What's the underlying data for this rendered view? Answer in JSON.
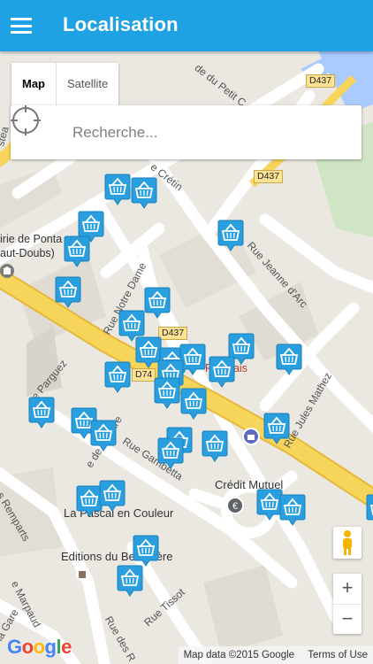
{
  "appbar": {
    "title": "Localisation",
    "menu_icon": "hamburger-menu-icon"
  },
  "map_type": {
    "map_label": "Map",
    "satellite_label": "Satellite",
    "selected": "Map"
  },
  "search": {
    "placeholder": "Recherche...",
    "value": "",
    "icon": "crosshair-locate-icon"
  },
  "map_labels": {
    "mairie_line1": "irie de Ponta",
    "mairie_line2": "aut-Doubs)",
    "credit_mutuel": "Crédit Mutuel",
    "francais": "Français",
    "la_couleur": "La Pascal en Couleur",
    "editions": "Editions du Belvédère"
  },
  "road_labels": {
    "du_petit_c": "de du Petit C",
    "d437_top": "D437",
    "d437_mid": "D437",
    "d437_low": "D437",
    "d74": "D74",
    "cretin": "e Crétin",
    "jeanne": "Rue Jeanne d'Arc",
    "notre_dame": "Rue Notre Dame",
    "parguez": "e Parguez",
    "de_la_gare": "e de la Gare",
    "gambetta": "Rue Gambetta",
    "jules_mathez": "Rue Jules Mathez",
    "remparts": "s Remparts",
    "marpaud": "e Marpaud",
    "tissot": "Rue Tissot",
    "des_r": "Rue des R",
    "la_gare": "la Gare",
    "steal": "stea"
  },
  "markers": {
    "icon": "shopping-basket-marker-icon",
    "count": 34
  },
  "controls": {
    "zoom_in": "+",
    "zoom_out": "−",
    "pegman_icon": "street-view-pegman-icon"
  },
  "footer": {
    "logo": "Google",
    "map_data": "Map data ©2015 Google",
    "terms": "Terms of Use"
  },
  "colors": {
    "appbar": "#1EA2E3",
    "marker": "#2A9FE0",
    "main_road": "#F5D24A",
    "map_bg": "#EBE8E1"
  }
}
